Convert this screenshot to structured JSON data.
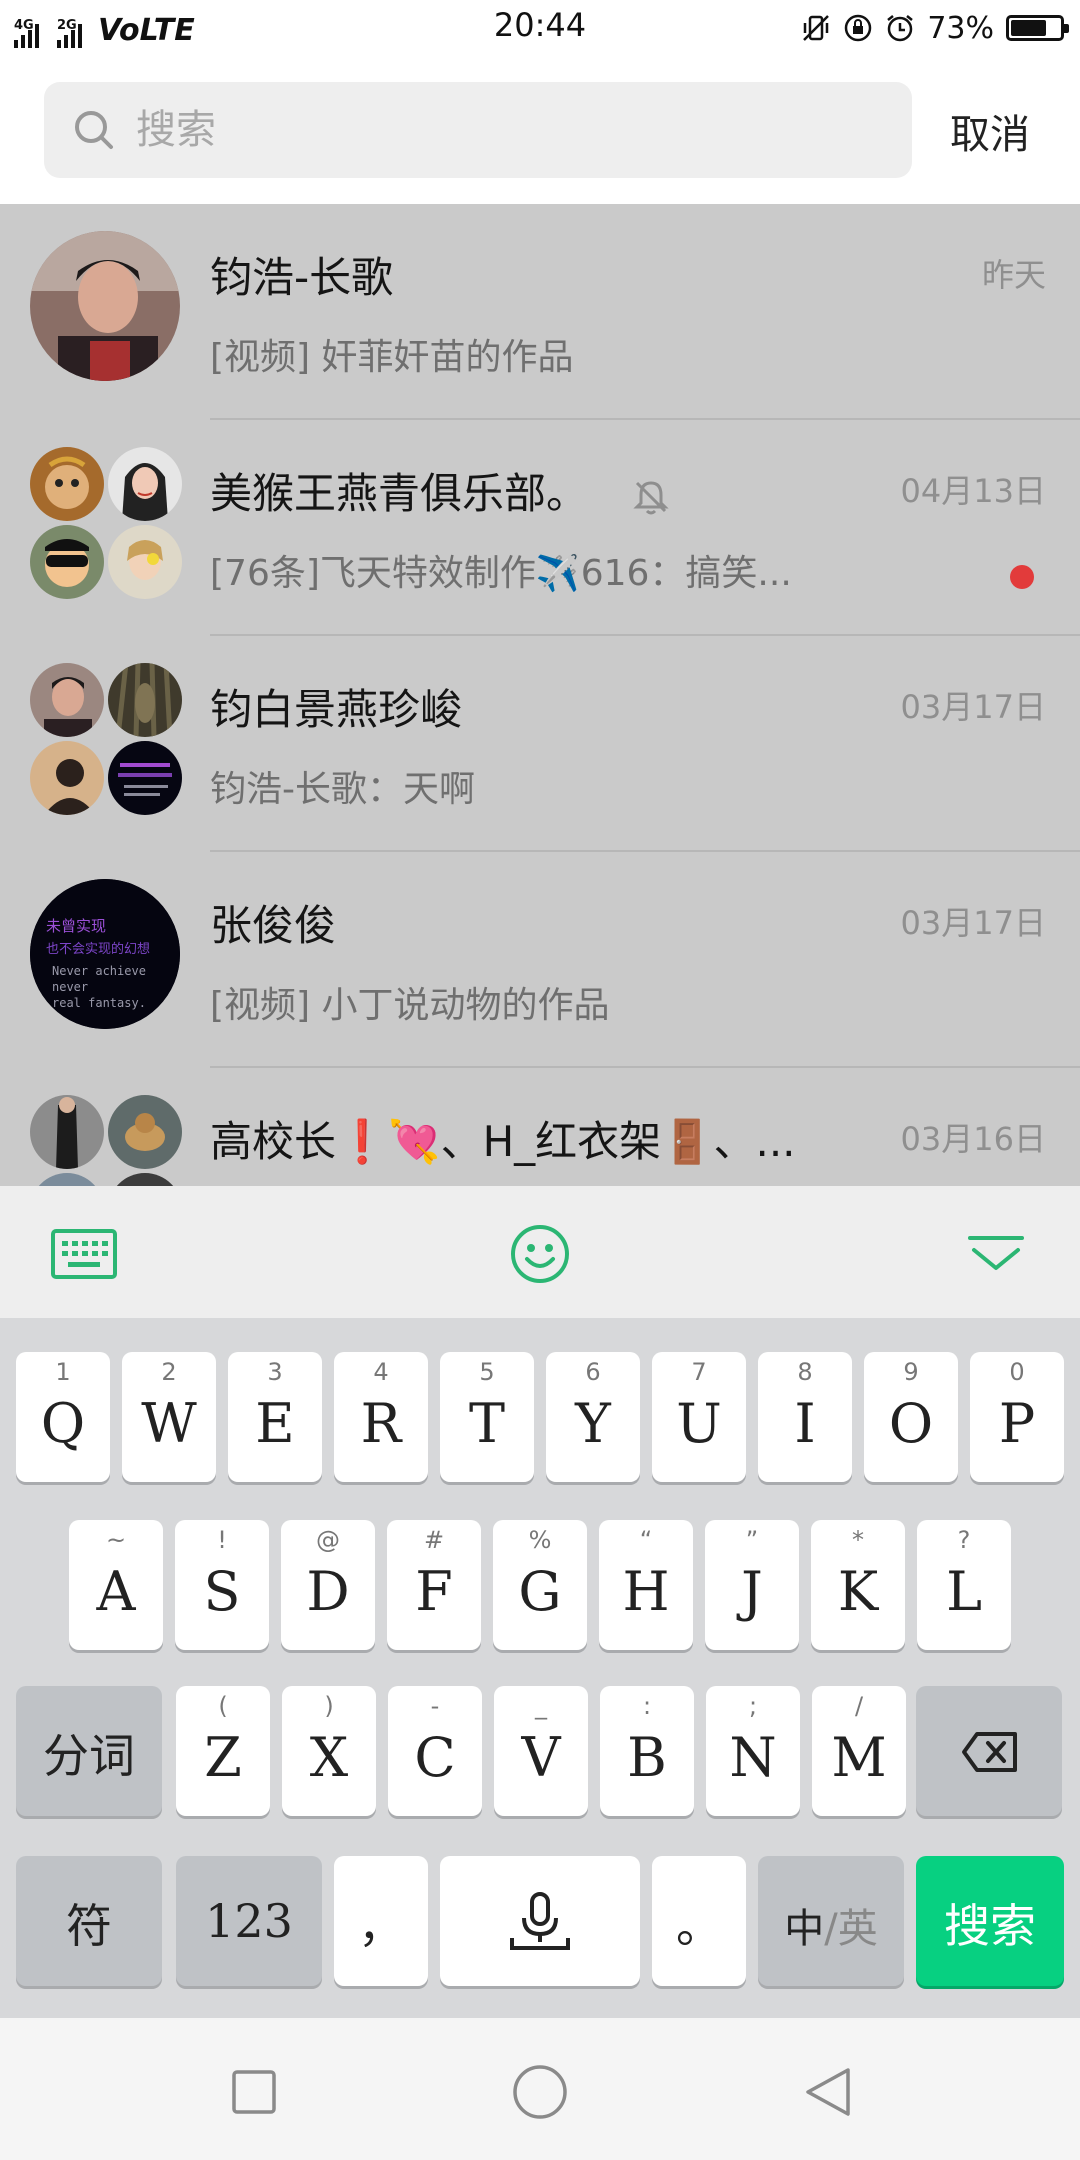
{
  "status_bar": {
    "net1": "4G",
    "net2": "2G",
    "volte": "VoLTE",
    "time": "20:44",
    "battery": "73%",
    "battery_level": 0.73
  },
  "search": {
    "placeholder": "搜索",
    "value": "",
    "cancel_label": "取消"
  },
  "results": [
    {
      "title": "钧浩-长歌",
      "subtitle": "[视频] 奸菲奸苗的作品",
      "time": "昨天",
      "muted": false,
      "unread": false
    },
    {
      "title": "美猴王燕青俱乐部。",
      "subtitle": "[76条]飞天特效制作✈️616：搞笑...",
      "time": "04月13日",
      "muted": true,
      "unread": true
    },
    {
      "title": "钧白景燕珍峻",
      "subtitle": "钧浩-长歌：天啊",
      "time": "03月17日",
      "muted": false,
      "unread": false
    },
    {
      "title": "张俊俊",
      "subtitle": "[视频] 小丁说动物的作品",
      "time": "03月17日",
      "muted": false,
      "unread": false
    },
    {
      "title": "高校长❗💘、H_红衣架🚪、...",
      "subtitle": "",
      "time": "03月16日",
      "muted": false,
      "unread": false
    }
  ],
  "avatar4_text": {
    "line1": "未曾实现",
    "line2": "也不会实现的幻想",
    "line3": "Never achieve",
    "line4": "never",
    "line5": "real fantasy."
  },
  "keyboard": {
    "row1": [
      {
        "hint": "1",
        "key": "Q"
      },
      {
        "hint": "2",
        "key": "W"
      },
      {
        "hint": "3",
        "key": "E"
      },
      {
        "hint": "4",
        "key": "R"
      },
      {
        "hint": "5",
        "key": "T"
      },
      {
        "hint": "6",
        "key": "Y"
      },
      {
        "hint": "7",
        "key": "U"
      },
      {
        "hint": "8",
        "key": "I"
      },
      {
        "hint": "9",
        "key": "O"
      },
      {
        "hint": "0",
        "key": "P"
      }
    ],
    "row2": [
      {
        "hint": "~",
        "key": "A"
      },
      {
        "hint": "!",
        "key": "S"
      },
      {
        "hint": "@",
        "key": "D"
      },
      {
        "hint": "#",
        "key": "F"
      },
      {
        "hint": "%",
        "key": "G"
      },
      {
        "hint": "“",
        "key": "H"
      },
      {
        "hint": "”",
        "key": "J"
      },
      {
        "hint": "*",
        "key": "K"
      },
      {
        "hint": "?",
        "key": "L"
      }
    ],
    "row3": [
      {
        "hint": "(",
        "key": "Z"
      },
      {
        "hint": ")",
        "key": "X"
      },
      {
        "hint": "-",
        "key": "C"
      },
      {
        "hint": "_",
        "key": "V"
      },
      {
        "hint": ":",
        "key": "B"
      },
      {
        "hint": ";",
        "key": "N"
      },
      {
        "hint": "/",
        "key": "M"
      }
    ],
    "segment_label": "分词",
    "symbols_label": "符",
    "numbers_label": "123",
    "comma_label": "，",
    "period_label": "。",
    "lang_zh": "中",
    "lang_sep": "/",
    "lang_en": "英",
    "search_label": "搜索"
  },
  "colors": {
    "accent_green": "#07d081",
    "toolbar_icon_green": "#2bb673",
    "unread_red": "#e23b3b"
  },
  "icons": [
    "search-icon",
    "keyboard-icon",
    "emoji-icon",
    "collapse-icon",
    "backspace-icon",
    "microphone-icon",
    "mute-icon",
    "back-icon",
    "home-icon",
    "recents-icon"
  ]
}
